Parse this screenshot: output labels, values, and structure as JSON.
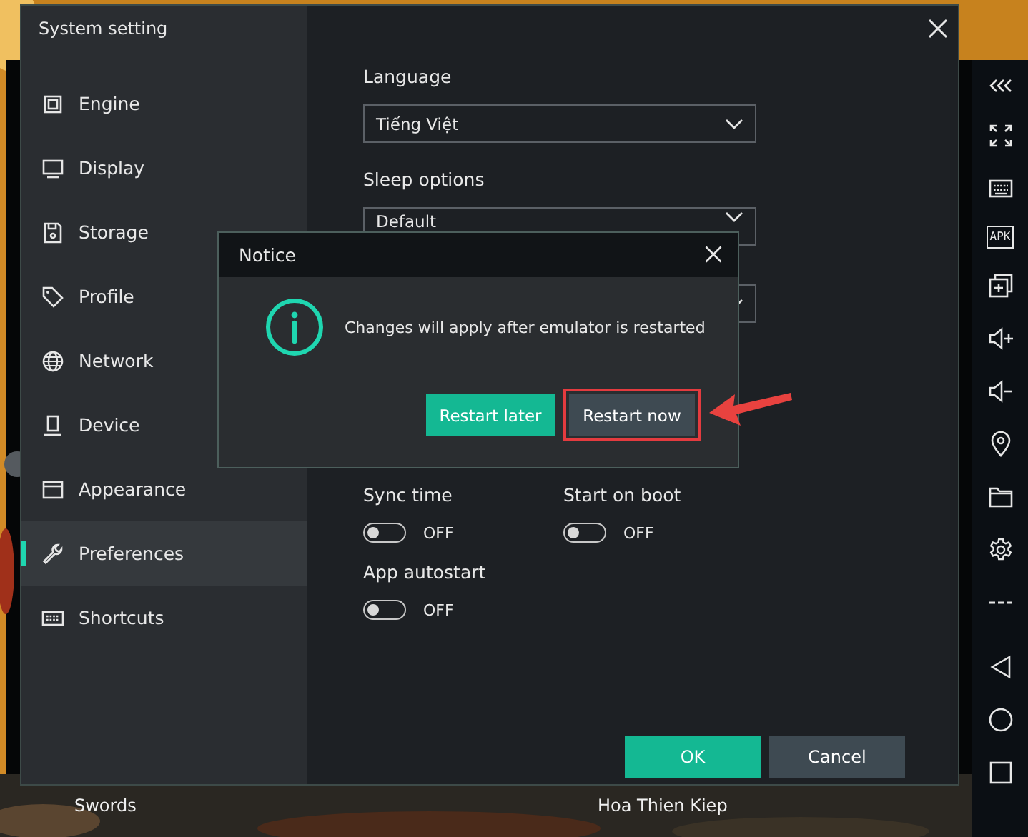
{
  "window": {
    "title": "System setting"
  },
  "sidebar": {
    "items": [
      {
        "label": "Engine",
        "kind": "chip",
        "selected": false
      },
      {
        "label": "Display",
        "kind": "monitor",
        "selected": false
      },
      {
        "label": "Storage",
        "kind": "disk",
        "selected": false
      },
      {
        "label": "Profile",
        "kind": "tag",
        "selected": false
      },
      {
        "label": "Network",
        "kind": "globe",
        "selected": false
      },
      {
        "label": "Device",
        "kind": "device",
        "selected": false
      },
      {
        "label": "Appearance",
        "kind": "window",
        "selected": false
      },
      {
        "label": "Preferences",
        "kind": "wrench",
        "selected": true
      },
      {
        "label": "Shortcuts",
        "kind": "keyboard",
        "selected": false
      }
    ]
  },
  "settings": {
    "language": {
      "label": "Language",
      "value": "Tiếng Việt"
    },
    "sleep": {
      "label": "Sleep options",
      "value": "Default"
    },
    "toggles": [
      {
        "label": "Sync time",
        "on": false,
        "state_text": "OFF"
      },
      {
        "label": "Start on boot",
        "on": false,
        "state_text": "OFF"
      },
      {
        "label": "App autostart",
        "on": false,
        "state_text": "OFF"
      }
    ]
  },
  "buttons": [
    {
      "label": "OK",
      "kind": "primary"
    },
    {
      "label": "Cancel",
      "kind": "secondary"
    }
  ],
  "notice": {
    "title": "Notice",
    "message": "Changes will apply after emulator is restarted",
    "buttons": [
      {
        "label": "Restart later",
        "kind": "primary",
        "highlighted": false
      },
      {
        "label": "Restart now",
        "kind": "secondary",
        "highlighted": true
      }
    ]
  },
  "toolbar": {
    "apk_label": "APK"
  },
  "background": {
    "labels": [
      "Swords",
      "Hoa Thien Kiep"
    ]
  }
}
